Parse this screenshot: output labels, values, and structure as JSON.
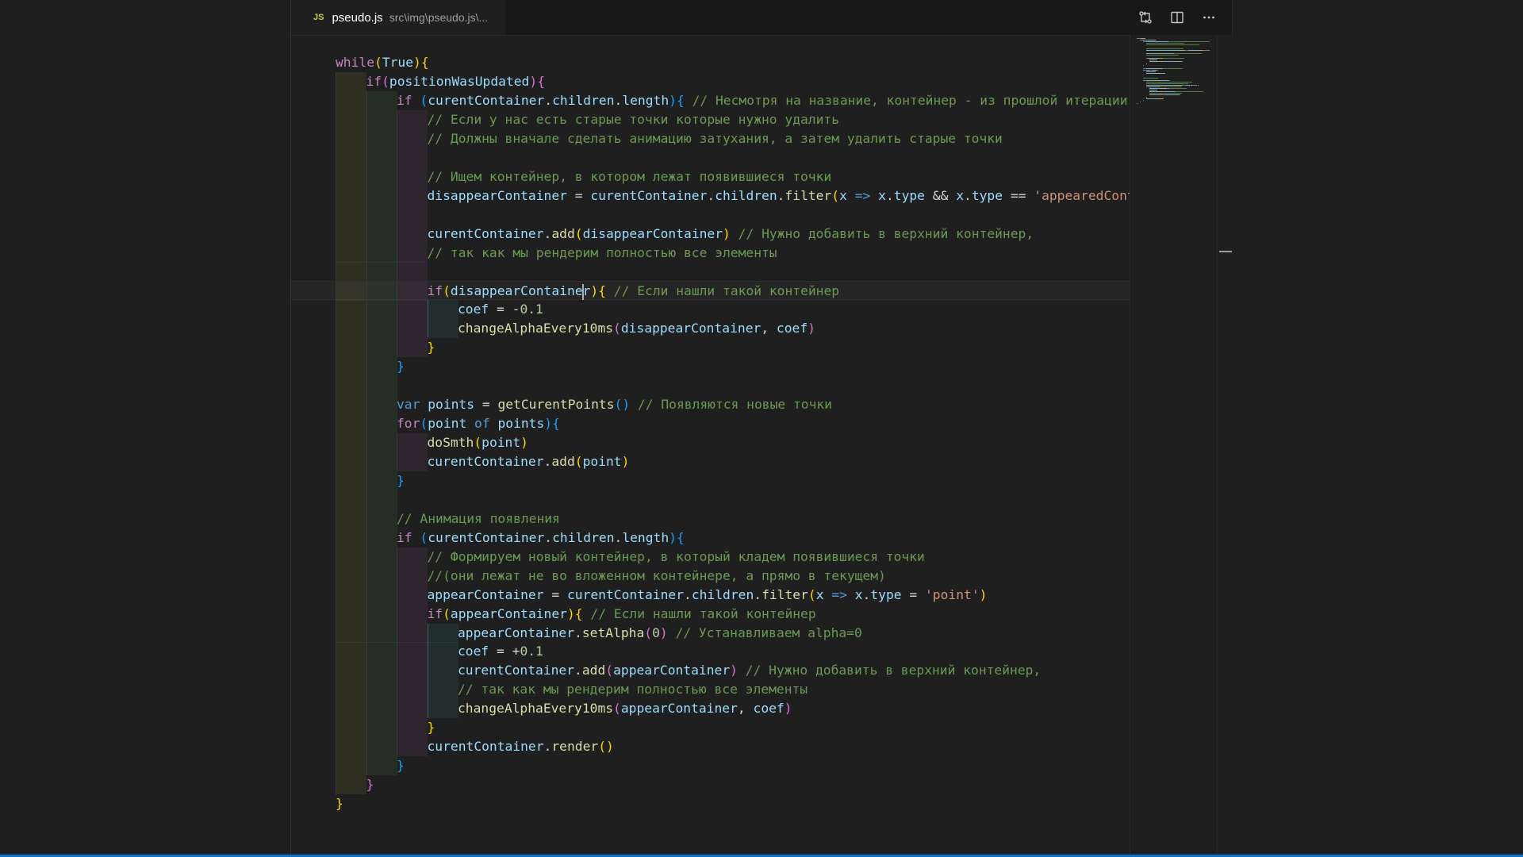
{
  "tab": {
    "lang_icon": "JS",
    "file_name": "pseudo.js",
    "file_path": "src\\img\\pseudo.js\\..."
  },
  "actions": [
    {
      "name": "open-changes-icon"
    },
    {
      "name": "split-editor-icon"
    },
    {
      "name": "more-actions-icon"
    }
  ],
  "colors": {
    "keyword": "#c586c0",
    "storage": "#569cd6",
    "variable": "#9cdcfe",
    "function": "#dcdcaa",
    "comment": "#6a9955",
    "string": "#ce9178",
    "number": "#b5cea8",
    "accent": "#0078d4"
  },
  "code_lines": [
    {
      "indent": 0,
      "tokens": [
        [
          "k",
          "while"
        ],
        [
          "b1",
          "("
        ],
        [
          "v",
          "True"
        ],
        [
          "b1",
          ")"
        ],
        [
          "b1",
          "{"
        ]
      ]
    },
    {
      "indent": 1,
      "tokens": [
        [
          "k",
          "if"
        ],
        [
          "b2",
          "("
        ],
        [
          "v",
          "positionWasUpdated"
        ],
        [
          "b2",
          ")"
        ],
        [
          "b2",
          "{"
        ]
      ]
    },
    {
      "indent": 2,
      "tokens": [
        [
          "k",
          "if "
        ],
        [
          "b3",
          "("
        ],
        [
          "v",
          "curentContainer"
        ],
        [
          "p",
          "."
        ],
        [
          "v",
          "children"
        ],
        [
          "p",
          "."
        ],
        [
          "v",
          "length"
        ],
        [
          "b3",
          ")"
        ],
        [
          "b3",
          "{"
        ],
        [
          "c",
          " // Несмотря на название, контейнер - из прошлой итерации"
        ]
      ]
    },
    {
      "indent": 3,
      "tokens": [
        [
          "c",
          "// Если у нас есть старые точки которые нужно удалить"
        ]
      ]
    },
    {
      "indent": 3,
      "tokens": [
        [
          "c",
          "// Должны вначале сделать анимацию затухания, а затем удалить старые точки"
        ]
      ]
    },
    {
      "indent": 3,
      "tokens": []
    },
    {
      "indent": 3,
      "tokens": [
        [
          "c",
          "// Ищем контейнер, в котором лежат появившиеся точки"
        ]
      ]
    },
    {
      "indent": 3,
      "tokens": [
        [
          "v",
          "disappearContainer"
        ],
        [
          "p",
          " = "
        ],
        [
          "v",
          "curentContainer"
        ],
        [
          "p",
          "."
        ],
        [
          "v",
          "children"
        ],
        [
          "p",
          "."
        ],
        [
          "f",
          "filter"
        ],
        [
          "b1",
          "("
        ],
        [
          "v",
          "x"
        ],
        [
          "kb",
          " => "
        ],
        [
          "v",
          "x"
        ],
        [
          "p",
          "."
        ],
        [
          "v",
          "type"
        ],
        [
          "p",
          " && "
        ],
        [
          "v",
          "x"
        ],
        [
          "p",
          "."
        ],
        [
          "v",
          "type"
        ],
        [
          "p",
          " == "
        ],
        [
          "s",
          "'appearedConta"
        ]
      ]
    },
    {
      "indent": 3,
      "tokens": []
    },
    {
      "indent": 3,
      "tokens": [
        [
          "v",
          "curentContainer"
        ],
        [
          "p",
          "."
        ],
        [
          "f",
          "add"
        ],
        [
          "b1",
          "("
        ],
        [
          "v",
          "disappearContainer"
        ],
        [
          "b1",
          ")"
        ],
        [
          "c",
          " // Нужно добавить в верхний контейнер,"
        ]
      ]
    },
    {
      "indent": 3,
      "tokens": [
        [
          "c",
          "// так как мы рендерим полностью все элементы"
        ]
      ]
    },
    {
      "indent": 3,
      "tokens": []
    },
    {
      "indent": 3,
      "current": true,
      "tokens": [
        [
          "k",
          "if"
        ],
        [
          "b1",
          "("
        ],
        [
          "v",
          "disappearContaine"
        ],
        [
          "cursor",
          ""
        ],
        [
          "v",
          "r"
        ],
        [
          "b1",
          ")"
        ],
        [
          "b1",
          "{"
        ],
        [
          "c",
          " // Если нашли такой контейнер"
        ]
      ]
    },
    {
      "indent": 4,
      "tokens": [
        [
          "v",
          "coef"
        ],
        [
          "p",
          " = "
        ],
        [
          "p",
          "-"
        ],
        [
          "n",
          "0.1"
        ]
      ]
    },
    {
      "indent": 4,
      "tokens": [
        [
          "f",
          "changeAlphaEvery10ms"
        ],
        [
          "b2",
          "("
        ],
        [
          "v",
          "disappearContainer"
        ],
        [
          "p",
          ", "
        ],
        [
          "v",
          "coef"
        ],
        [
          "b2",
          ")"
        ]
      ]
    },
    {
      "indent": 3,
      "tokens": [
        [
          "b1",
          "}"
        ]
      ]
    },
    {
      "indent": 2,
      "tokens": [
        [
          "b3",
          "}"
        ]
      ]
    },
    {
      "indent": 2,
      "tokens": []
    },
    {
      "indent": 2,
      "tokens": [
        [
          "kb",
          "var "
        ],
        [
          "v",
          "points"
        ],
        [
          "p",
          " = "
        ],
        [
          "f",
          "getCurentPoints"
        ],
        [
          "b3",
          "()"
        ],
        [
          "c",
          " // Появляются новые точки"
        ]
      ]
    },
    {
      "indent": 2,
      "tokens": [
        [
          "k",
          "for"
        ],
        [
          "b3",
          "("
        ],
        [
          "v",
          "point"
        ],
        [
          "kb",
          " of "
        ],
        [
          "v",
          "points"
        ],
        [
          "b3",
          ")"
        ],
        [
          "b3",
          "{"
        ]
      ]
    },
    {
      "indent": 3,
      "tokens": [
        [
          "f",
          "doSmth"
        ],
        [
          "b1",
          "("
        ],
        [
          "v",
          "point"
        ],
        [
          "b1",
          ")"
        ]
      ]
    },
    {
      "indent": 3,
      "tokens": [
        [
          "v",
          "curentContainer"
        ],
        [
          "p",
          "."
        ],
        [
          "f",
          "add"
        ],
        [
          "b1",
          "("
        ],
        [
          "v",
          "point"
        ],
        [
          "b1",
          ")"
        ]
      ]
    },
    {
      "indent": 2,
      "tokens": [
        [
          "b3",
          "}"
        ]
      ]
    },
    {
      "indent": 2,
      "tokens": []
    },
    {
      "indent": 2,
      "tokens": [
        [
          "c",
          "// Анимация появления"
        ]
      ]
    },
    {
      "indent": 2,
      "tokens": [
        [
          "k",
          "if "
        ],
        [
          "b3",
          "("
        ],
        [
          "v",
          "curentContainer"
        ],
        [
          "p",
          "."
        ],
        [
          "v",
          "children"
        ],
        [
          "p",
          "."
        ],
        [
          "v",
          "length"
        ],
        [
          "b3",
          ")"
        ],
        [
          "b3",
          "{"
        ]
      ]
    },
    {
      "indent": 3,
      "tokens": [
        [
          "c",
          "// Формируем новый контейнер, в который кладем появившиеся точки"
        ]
      ]
    },
    {
      "indent": 3,
      "tokens": [
        [
          "c",
          "//(они лежат не во вложенном контейнере, а прямо в текущем)"
        ]
      ]
    },
    {
      "indent": 3,
      "tokens": [
        [
          "v",
          "appearContainer"
        ],
        [
          "p",
          " = "
        ],
        [
          "v",
          "curentContainer"
        ],
        [
          "p",
          "."
        ],
        [
          "v",
          "children"
        ],
        [
          "p",
          "."
        ],
        [
          "f",
          "filter"
        ],
        [
          "b1",
          "("
        ],
        [
          "v",
          "x"
        ],
        [
          "kb",
          " => "
        ],
        [
          "v",
          "x"
        ],
        [
          "p",
          "."
        ],
        [
          "v",
          "type"
        ],
        [
          "p",
          " = "
        ],
        [
          "s",
          "'point'"
        ],
        [
          "b1",
          ")"
        ]
      ]
    },
    {
      "indent": 3,
      "tokens": [
        [
          "k",
          "if"
        ],
        [
          "b1",
          "("
        ],
        [
          "v",
          "appearContainer"
        ],
        [
          "b1",
          ")"
        ],
        [
          "b1",
          "{"
        ],
        [
          "c",
          " // Если нашли такой контейнер"
        ]
      ]
    },
    {
      "indent": 4,
      "tokens": [
        [
          "v",
          "appearContainer"
        ],
        [
          "p",
          "."
        ],
        [
          "f",
          "setAlpha"
        ],
        [
          "b2",
          "("
        ],
        [
          "n",
          "0"
        ],
        [
          "b2",
          ")"
        ],
        [
          "c",
          " // Устанавливаем alpha=0"
        ]
      ]
    },
    {
      "indent": 4,
      "tokens": [
        [
          "v",
          "coef"
        ],
        [
          "p",
          " = "
        ],
        [
          "p",
          "+"
        ],
        [
          "n",
          "0.1"
        ]
      ]
    },
    {
      "indent": 4,
      "tokens": [
        [
          "v",
          "curentContainer"
        ],
        [
          "p",
          "."
        ],
        [
          "f",
          "add"
        ],
        [
          "b2",
          "("
        ],
        [
          "v",
          "appearContainer"
        ],
        [
          "b2",
          ")"
        ],
        [
          "c",
          " // Нужно добавить в верхний контейнер,"
        ]
      ]
    },
    {
      "indent": 4,
      "tokens": [
        [
          "c",
          "// так как мы рендерим полностью все элементы"
        ]
      ]
    },
    {
      "indent": 4,
      "tokens": [
        [
          "f",
          "changeAlphaEvery10ms"
        ],
        [
          "b2",
          "("
        ],
        [
          "v",
          "appearContainer"
        ],
        [
          "p",
          ", "
        ],
        [
          "v",
          "coef"
        ],
        [
          "b2",
          ")"
        ]
      ]
    },
    {
      "indent": 3,
      "tokens": [
        [
          "b1",
          "}"
        ]
      ]
    },
    {
      "indent": 3,
      "tokens": [
        [
          "v",
          "curentContainer"
        ],
        [
          "p",
          "."
        ],
        [
          "f",
          "render"
        ],
        [
          "b1",
          "()"
        ]
      ]
    },
    {
      "indent": 2,
      "tokens": [
        [
          "b3",
          "}"
        ]
      ]
    },
    {
      "indent": 1,
      "tokens": [
        [
          "b2",
          "}"
        ]
      ]
    },
    {
      "indent": 0,
      "tokens": [
        [
          "b1",
          "}"
        ]
      ]
    }
  ]
}
